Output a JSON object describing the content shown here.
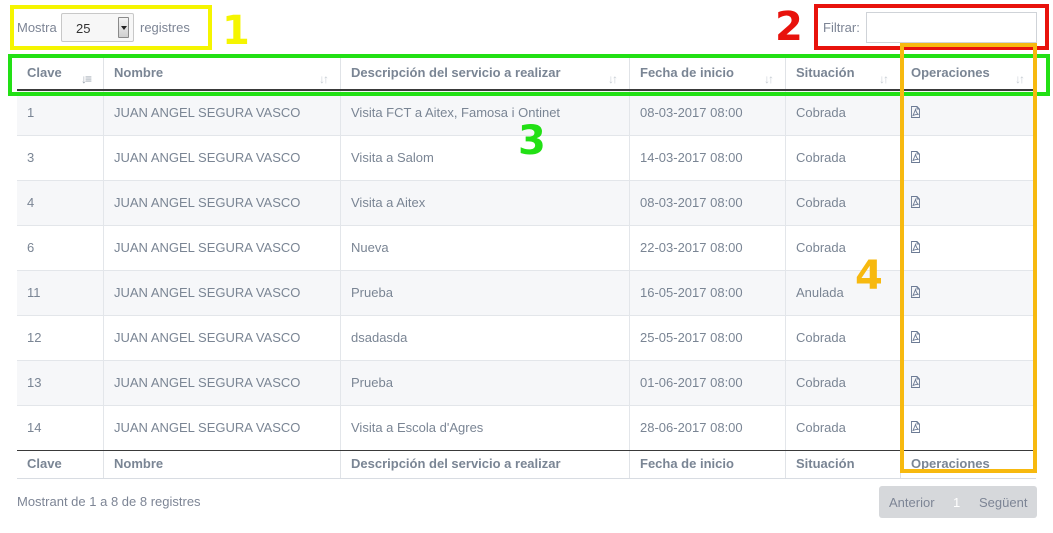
{
  "length_menu": {
    "prefix": "Mostra",
    "value": "25",
    "suffix": "registres"
  },
  "filter": {
    "label": "Filtrar:",
    "value": ""
  },
  "columns": [
    "Clave",
    "Nombre",
    "Descripción del servicio a realizar",
    "Fecha de inicio",
    "Situación",
    "Operaciones"
  ],
  "rows": [
    {
      "clave": "1",
      "nombre": "JUAN ANGEL SEGURA VASCO",
      "descripcion": "Visita FCT a Aitex, Famosa i Ontinet",
      "fecha": "08-03-2017 08:00",
      "situacion": "Cobrada",
      "operacion_icon": "pdf-icon"
    },
    {
      "clave": "3",
      "nombre": "JUAN ANGEL SEGURA VASCO",
      "descripcion": "Visita a Salom",
      "fecha": "14-03-2017 08:00",
      "situacion": "Cobrada",
      "operacion_icon": "pdf-icon"
    },
    {
      "clave": "4",
      "nombre": "JUAN ANGEL SEGURA VASCO",
      "descripcion": "Visita a Aitex",
      "fecha": "08-03-2017 08:00",
      "situacion": "Cobrada",
      "operacion_icon": "pdf-icon"
    },
    {
      "clave": "6",
      "nombre": "JUAN ANGEL SEGURA VASCO",
      "descripcion": "Nueva",
      "fecha": "22-03-2017 08:00",
      "situacion": "Cobrada",
      "operacion_icon": "pdf-icon"
    },
    {
      "clave": "11",
      "nombre": "JUAN ANGEL SEGURA VASCO",
      "descripcion": "Prueba",
      "fecha": "16-05-2017 08:00",
      "situacion": "Anulada",
      "operacion_icon": "pdf-icon"
    },
    {
      "clave": "12",
      "nombre": "JUAN ANGEL SEGURA VASCO",
      "descripcion": "dsadasda",
      "fecha": "25-05-2017 08:00",
      "situacion": "Cobrada",
      "operacion_icon": "pdf-icon"
    },
    {
      "clave": "13",
      "nombre": "JUAN ANGEL SEGURA VASCO",
      "descripcion": "Prueba",
      "fecha": "01-06-2017 08:00",
      "situacion": "Cobrada",
      "operacion_icon": "pdf-icon"
    },
    {
      "clave": "14",
      "nombre": "JUAN ANGEL SEGURA VASCO",
      "descripcion": "Visita a Escola d'Agres",
      "fecha": "28-06-2017 08:00",
      "situacion": "Cobrada",
      "operacion_icon": "pdf-icon"
    }
  ],
  "info": "Mostrant de 1 a 8 de 8 registres",
  "pagination": {
    "previous": "Anterior",
    "current": "1",
    "next": "Següent"
  },
  "annotations": [
    {
      "number": "1",
      "color": "#f5f500"
    },
    {
      "number": "2",
      "color": "#e8120c"
    },
    {
      "number": "3",
      "color": "#22e015"
    },
    {
      "number": "4",
      "color": "#f7b90f"
    }
  ],
  "colors": {
    "text": "#7a8594",
    "row_stripe": "#f6f7f9",
    "pager_bg": "#d6d8db"
  }
}
